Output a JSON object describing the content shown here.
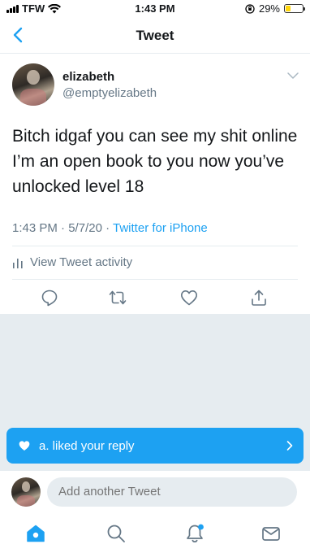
{
  "status_bar": {
    "carrier": "TFW",
    "time": "1:43 PM",
    "battery": "29%",
    "battery_level": 0.29
  },
  "header": {
    "title": "Tweet"
  },
  "tweet": {
    "display_name": "elizabeth",
    "handle": "@emptyelizabeth",
    "text": "Bitch idgaf you can see my shit online I’m an open book to you now you’ve unlocked level 18",
    "time": "1:43 PM",
    "date": "5/7/20",
    "separator": "·",
    "source": "Twitter for iPhone",
    "activity_label": "View Tweet activity"
  },
  "toast": {
    "text": "a. liked your reply"
  },
  "reply": {
    "placeholder": "Add another Tweet"
  },
  "colors": {
    "accent": "#1da1f2",
    "muted": "#657786",
    "divider": "#e6ecf0",
    "battery": "#ffd60a",
    "badge": "#1da1f2"
  },
  "icons": [
    "back-chevron-icon",
    "caret-down-icon",
    "bar-chart-icon",
    "reply-icon",
    "retweet-icon",
    "like-icon",
    "share-icon",
    "heart-icon",
    "chevron-right-icon",
    "home-icon",
    "search-icon",
    "notifications-icon",
    "messages-icon"
  ]
}
